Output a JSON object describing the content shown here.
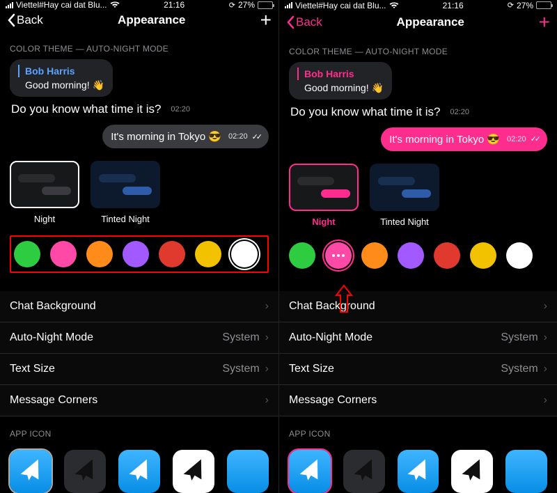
{
  "status": {
    "carrier": "Viettel#Hay cai dat Blu...",
    "time": "21:16",
    "battery_pct": "27%"
  },
  "nav": {
    "back": "Back",
    "title": "Appearance"
  },
  "section": {
    "color_theme": "COLOR THEME — AUTO-NIGHT MODE",
    "app_icon": "APP ICON"
  },
  "chat": {
    "sender": "Bob Harris",
    "greeting": "Good morning! 👋",
    "question": "Do you know what time it is?",
    "q_time": "02:20",
    "reply": "It's morning in Tokyo 😎",
    "r_time": "02:20"
  },
  "themes": {
    "night": "Night",
    "tinted": "Tinted Night"
  },
  "swatches": {
    "c0": "#2ecc40",
    "c1": "#ff49a6",
    "c2": "#ff8c1a",
    "c3": "#a259ff",
    "c4": "#e03a2f",
    "c5": "#f2c200",
    "c6": "#ffffff"
  },
  "cells": {
    "bg": "Chat Background",
    "auto": "Auto-Night Mode",
    "auto_v": "System",
    "text": "Text Size",
    "text_v": "System",
    "corners": "Message Corners"
  }
}
